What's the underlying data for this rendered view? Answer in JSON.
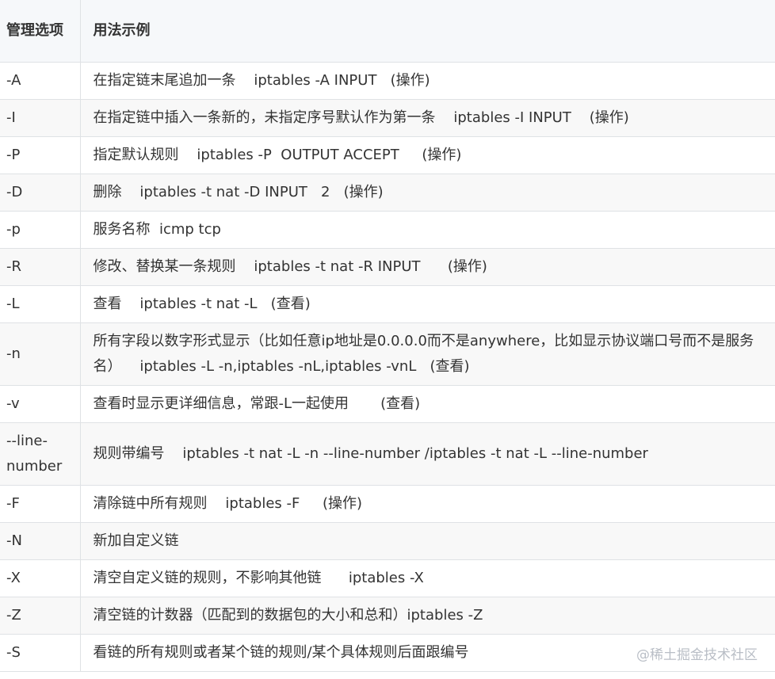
{
  "header": {
    "option": "管理选项",
    "usage": "用法示例"
  },
  "rows": [
    {
      "option": "-A",
      "usage": "在指定链末尾追加一条    iptables -A INPUT   (操作)"
    },
    {
      "option": "-I",
      "usage": "在指定链中插入一条新的，未指定序号默认作为第一条    iptables -I INPUT    (操作)"
    },
    {
      "option": "-P",
      "usage": "指定默认规则    iptables -P  OUTPUT ACCEPT     (操作)"
    },
    {
      "option": "-D",
      "usage": "删除    iptables -t nat -D INPUT   2   (操作)"
    },
    {
      "option": "-p",
      "usage": "服务名称  icmp tcp"
    },
    {
      "option": "-R",
      "usage": "修改、替换某一条规则    iptables -t nat -R INPUT      (操作)"
    },
    {
      "option": "-L",
      "usage": "查看    iptables -t nat -L   (查看)"
    },
    {
      "option": "-n",
      "usage": "所有字段以数字形式显示（比如任意ip地址是0.0.0.0而不是anywhere，比如显示协议端口号而不是服务名）    iptables -L -n,iptables -nL,iptables -vnL   (查看)"
    },
    {
      "option": "-v",
      "usage": "查看时显示更详细信息，常跟-L一起使用       (查看)"
    },
    {
      "option": "--line-number",
      "usage": "规则带编号    iptables -t nat -L -n --line-number /iptables -t nat -L --line-number"
    },
    {
      "option": "-F",
      "usage": "清除链中所有规则    iptables -F     (操作)"
    },
    {
      "option": "-N",
      "usage": "新加自定义链"
    },
    {
      "option": "-X",
      "usage": "清空自定义链的规则，不影响其他链      iptables -X"
    },
    {
      "option": "-Z",
      "usage": "清空链的计数器（匹配到的数据包的大小和总和）iptables -Z"
    },
    {
      "option": "-S",
      "usage": "看链的所有规则或者某个链的规则/某个具体规则后面跟编号"
    }
  ],
  "watermark": "@稀土掘金技术社区"
}
